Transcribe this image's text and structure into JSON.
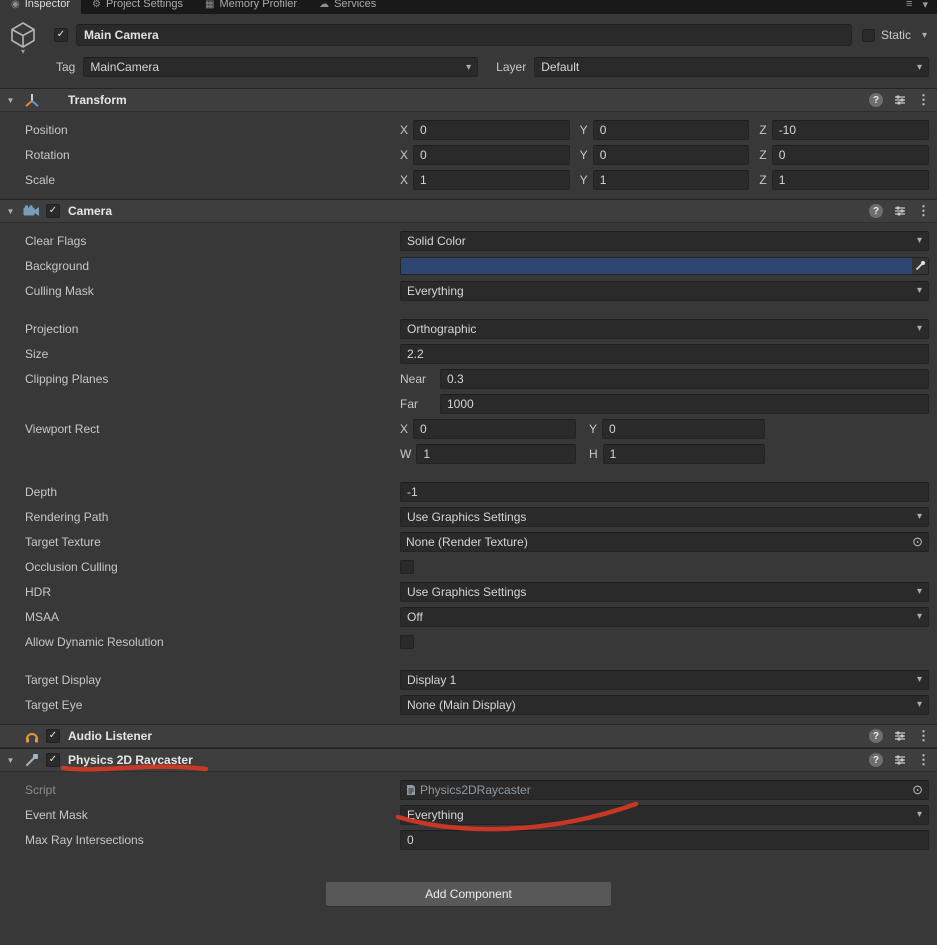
{
  "tabbar": {
    "tabs": [
      {
        "label": "Inspector",
        "icon": "◉"
      },
      {
        "label": "Project Settings",
        "icon": "⚙"
      },
      {
        "label": "Memory Profiler",
        "icon": "▦"
      },
      {
        "label": "Services",
        "icon": "☁"
      }
    ]
  },
  "icons": {
    "dropdown": "▾",
    "foldout": "▼",
    "check": "✓",
    "help": "?",
    "menu": "⋮",
    "picker": "⊙",
    "hamburger": "≡",
    "caret": "▾"
  },
  "game_object": {
    "name": "Main Camera",
    "static_label": "Static",
    "tag_label": "Tag",
    "tag_value": "MainCamera",
    "layer_label": "Layer",
    "layer_value": "Default"
  },
  "transform": {
    "title": "Transform",
    "rows": [
      {
        "label": "Position",
        "axes": [
          "X",
          "Y",
          "Z"
        ],
        "values": [
          "0",
          "0",
          "-10"
        ]
      },
      {
        "label": "Rotation",
        "axes": [
          "X",
          "Y",
          "Z"
        ],
        "values": [
          "0",
          "0",
          "0"
        ]
      },
      {
        "label": "Scale",
        "axes": [
          "X",
          "Y",
          "Z"
        ],
        "values": [
          "1",
          "1",
          "1"
        ]
      }
    ]
  },
  "camera": {
    "title": "Camera",
    "clear_flags_label": "Clear Flags",
    "clear_flags_value": "Solid Color",
    "background_label": "Background",
    "background_color": "#2F4572",
    "culling_mask_label": "Culling Mask",
    "culling_mask_value": "Everything",
    "projection_label": "Projection",
    "projection_value": "Orthographic",
    "size_label": "Size",
    "size_value": "2.2",
    "clipping_label": "Clipping Planes",
    "near_label": "Near",
    "near_value": "0.3",
    "far_label": "Far",
    "far_value": "1000",
    "viewport_label": "Viewport Rect",
    "viewport": {
      "x_label": "X",
      "x": "0",
      "y_label": "Y",
      "y": "0",
      "w_label": "W",
      "w": "1",
      "h_label": "H",
      "h": "1"
    },
    "depth_label": "Depth",
    "depth_value": "-1",
    "rendering_path_label": "Rendering Path",
    "rendering_path_value": "Use Graphics Settings",
    "target_texture_label": "Target Texture",
    "target_texture_value": "None (Render Texture)",
    "occlusion_label": "Occlusion Culling",
    "hdr_label": "HDR",
    "hdr_value": "Use Graphics Settings",
    "msaa_label": "MSAA",
    "msaa_value": "Off",
    "dynamic_res_label": "Allow Dynamic Resolution",
    "target_display_label": "Target Display",
    "target_display_value": "Display 1",
    "target_eye_label": "Target Eye",
    "target_eye_value": "None (Main Display)"
  },
  "audio_listener": {
    "title": "Audio Listener"
  },
  "raycaster": {
    "title": "Physics 2D Raycaster",
    "script_label": "Script",
    "script_value": "Physics2DRaycaster",
    "event_mask_label": "Event Mask",
    "event_mask_value": "Everything",
    "max_ray_label": "Max Ray Intersections",
    "max_ray_value": "0"
  },
  "footer": {
    "add_component": "Add Component"
  },
  "annotations": {
    "color": "#D53A24"
  }
}
